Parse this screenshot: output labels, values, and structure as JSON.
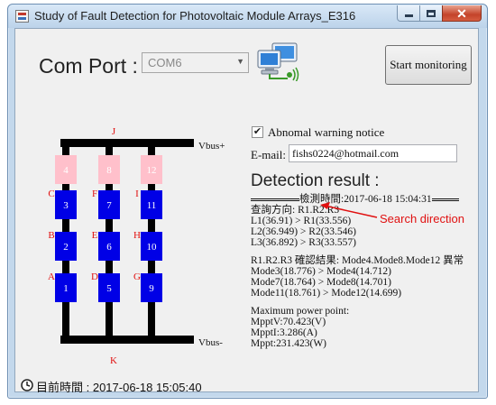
{
  "window": {
    "title": "Study of Fault Detection for Photovoltaic Module Arrays_E316",
    "buttons": [
      "minimize",
      "maximize",
      "close"
    ],
    "close_glyph": "✕",
    "app_icon": "app-icon"
  },
  "toolbar": {
    "com_label": "Com Port :",
    "com_value": "COM6",
    "dropdown_arrow": "▼",
    "network_icon": "network-computer-icon",
    "start_label": "Start monitoring"
  },
  "circuit": {
    "top_label": "J",
    "bottom_label": "K",
    "vbus_pos": "Vbus+",
    "vbus_neg": "Vbus-",
    "columns": [
      {
        "top_module": "4",
        "modules": [
          "3",
          "2",
          "1"
        ],
        "nodes": [
          "C",
          "B",
          "A"
        ]
      },
      {
        "top_module": "8",
        "modules": [
          "7",
          "6",
          "5"
        ],
        "nodes": [
          "F",
          "E",
          "D"
        ]
      },
      {
        "top_module": "12",
        "modules": [
          "11",
          "10",
          "9"
        ],
        "nodes": [
          "I",
          "H",
          "G"
        ]
      }
    ],
    "colors": {
      "module": "#0000e6",
      "faulty_module": "#ffc0cb",
      "wire": "#000000",
      "node_label": "#e01010"
    }
  },
  "settings": {
    "abnormal_label": "Abnomal warning notice",
    "abnormal_checked": true,
    "check_mark": "✔",
    "email_label": "E-mail:",
    "email_value": "fishs0224@hotmail.com"
  },
  "result": {
    "title": "Detection result :",
    "timestamp": "檢測時間:2017-06-18  15:04:31",
    "direction": "查詢方向: R1.R2.R3",
    "comparisons": [
      "L1(36.91) > R1(33.556)",
      "L2(36.949) > R2(33.546)",
      "L3(36.892) > R3(33.557)"
    ],
    "confirm": "R1.R2.R3 確認結果: Mode4.Mode8.Mode12 異常",
    "modes": [
      "Mode3(18.776) > Mode4(14.712)",
      "Mode7(18.764) > Mode8(14.701)",
      "Mode11(18.761) > Mode12(14.699)"
    ],
    "mpp_title": "Maximum  power  point:",
    "mpp": [
      "MpptV:70.423(V)",
      "MpptI:3.286(A)",
      "Mppt:231.423(W)"
    ],
    "annotation": "Search direction",
    "annotation_color": "#e01010"
  },
  "status": {
    "icon": "clock-icon",
    "text": "目前時間 : 2017-06-18  15:05:40"
  }
}
